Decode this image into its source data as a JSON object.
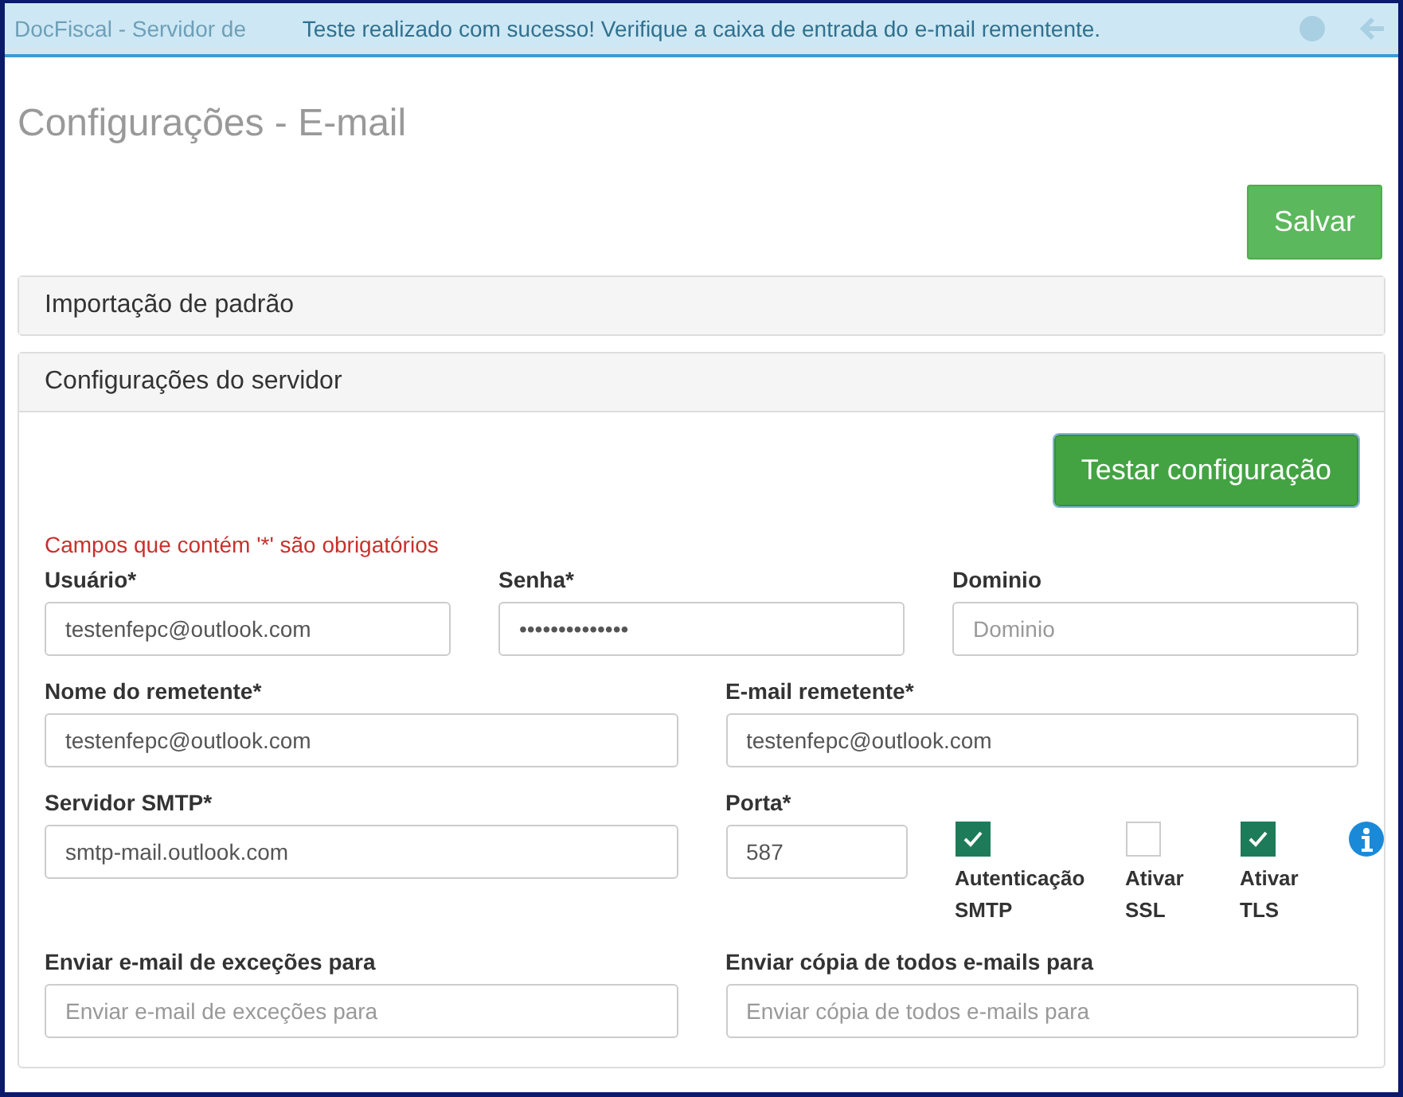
{
  "header": {
    "title": "DocFiscal - Servidor de"
  },
  "alert": {
    "text": "Teste realizado com sucesso! Verifique a caixa de entrada do e-mail rementente."
  },
  "page_title": "Configurações - E-mail",
  "save_button": "Salvar",
  "panels": [
    {
      "title": "Importação de padrão",
      "expanded": false
    },
    {
      "title": "Configurações do servidor",
      "expanded": true
    }
  ],
  "test_button": "Testar configuração",
  "required_note": "Campos que contém '*' são obrigatórios",
  "rows": [
    {
      "fields": [
        {
          "label": "Usuário*",
          "value": "testenfepc@outlook.com",
          "kind": "text"
        },
        {
          "label": "Senha*",
          "value": "••••••••••••••",
          "kind": "password"
        },
        {
          "label": "Dominio",
          "placeholder": "Dominio",
          "kind": "text"
        }
      ]
    },
    {
      "fields": [
        {
          "label": "Nome do remetente*",
          "value": "testenfepc@outlook.com",
          "kind": "text"
        },
        {
          "label": "E-mail remetente*",
          "value": "testenfepc@outlook.com",
          "kind": "text"
        }
      ]
    },
    {
      "fields": [
        {
          "label": "Servidor SMTP*",
          "value": "smtp-mail.outlook.com",
          "kind": "text"
        },
        {
          "label": "Porta*",
          "value": "587",
          "kind": "port"
        }
      ]
    },
    {
      "fields": [
        {
          "label": "Enviar e-mail de exceções para",
          "placeholder": "Enviar e-mail de exceções para",
          "kind": "text"
        },
        {
          "label": "Enviar cópia de todos e-mails para",
          "placeholder": "Enviar cópia de todos e-mails para",
          "kind": "text"
        }
      ]
    }
  ],
  "checkboxes": [
    {
      "label": "Autenticação SMTP",
      "checked": true
    },
    {
      "label": "Ativar SSL",
      "checked": false
    },
    {
      "label": "Ativar TLS",
      "checked": true
    }
  ]
}
